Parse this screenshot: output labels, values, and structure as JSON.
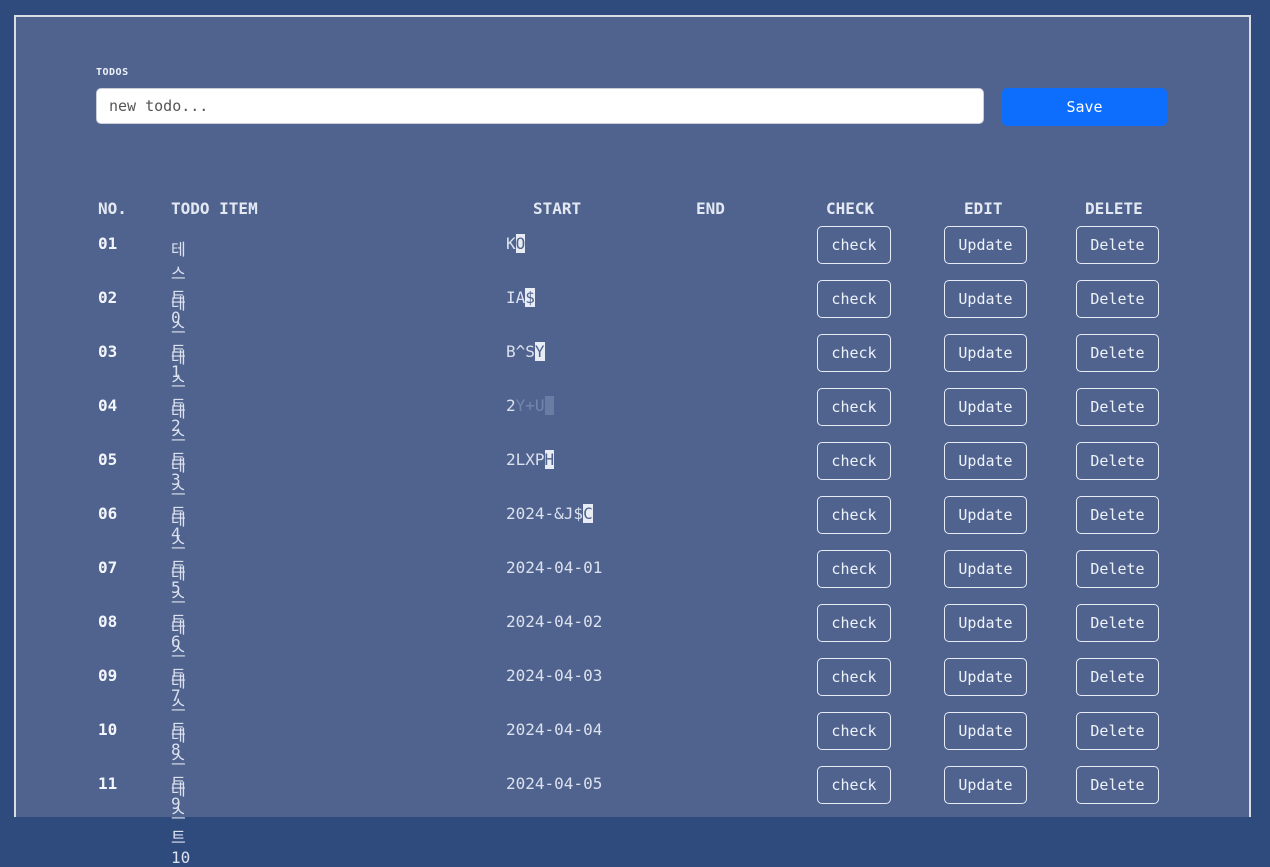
{
  "section_label": "TODOS",
  "new_todo": {
    "value": "",
    "placeholder": "new todo..."
  },
  "save_label": "Save",
  "headers": {
    "no": "NO.",
    "item": "TODO ITEM",
    "start": "START",
    "end": "END",
    "check": "CHECK",
    "edit": "EDIT",
    "delete": "DELETE"
  },
  "buttons": {
    "check": "check",
    "update": "Update",
    "delete": "Delete"
  },
  "rows": [
    {
      "no": "01",
      "item": "테스트0",
      "start": "K",
      "start_dim": "",
      "cursor": "O",
      "end": ""
    },
    {
      "no": "02",
      "item": "테스트1",
      "start": "IA",
      "start_dim": "",
      "cursor": "$",
      "end": ""
    },
    {
      "no": "03",
      "item": "테스트2",
      "start": "B^S",
      "start_dim": "",
      "cursor": "Y",
      "end": ""
    },
    {
      "no": "04",
      "item": "테스트3",
      "start": "2",
      "start_dim": "Y+U",
      "cursor": " ",
      "end": ""
    },
    {
      "no": "05",
      "item": "테스트4",
      "start": "2LXP",
      "start_dim": "",
      "cursor": "H",
      "end": ""
    },
    {
      "no": "06",
      "item": "테스트5",
      "start": "2024-&J$",
      "start_dim": "",
      "cursor": "C",
      "end": ""
    },
    {
      "no": "07",
      "item": "테스트6",
      "start": "2024-04-01",
      "start_dim": "",
      "cursor": "",
      "end": ""
    },
    {
      "no": "08",
      "item": "테스트7",
      "start": "2024-04-02",
      "start_dim": "",
      "cursor": "",
      "end": ""
    },
    {
      "no": "09",
      "item": "테스트8",
      "start": "2024-04-03",
      "start_dim": "",
      "cursor": "",
      "end": ""
    },
    {
      "no": "10",
      "item": "테스트9",
      "start": "2024-04-04",
      "start_dim": "",
      "cursor": "",
      "end": ""
    },
    {
      "no": "11",
      "item": "테스트10",
      "start": "2024-04-05",
      "start_dim": "",
      "cursor": "",
      "end": ""
    }
  ],
  "colors": {
    "page_bg": "#2f4a7c",
    "panel_bg": "#4f638e",
    "primary": "#0d6efd"
  }
}
